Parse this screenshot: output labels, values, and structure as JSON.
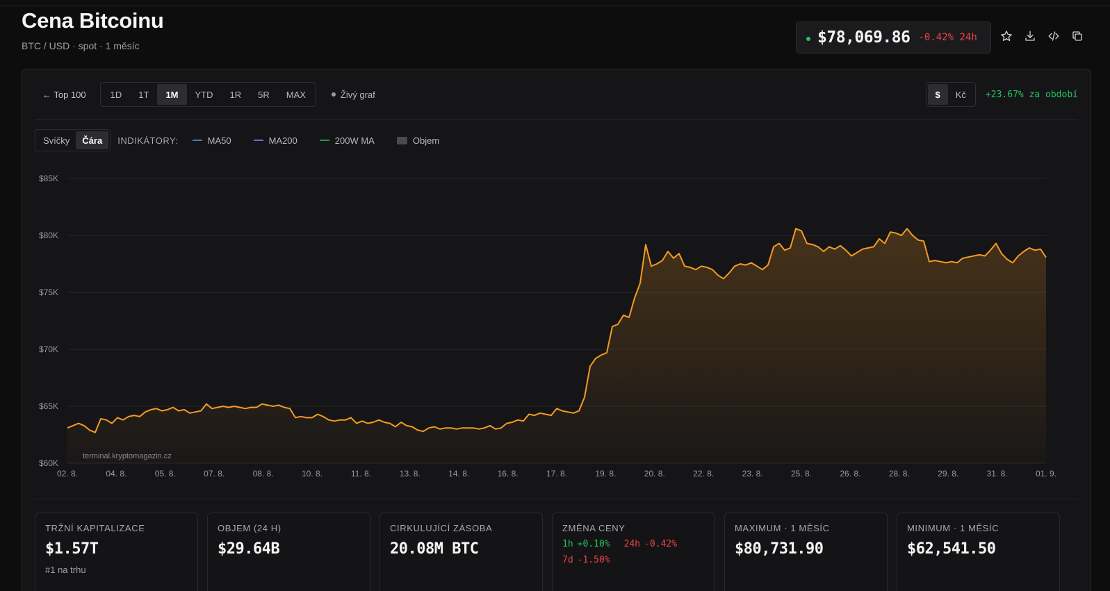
{
  "header": {
    "title": "Cena Bitcoinu",
    "subtitle": "BTC / USD · spot · 1 měsíc"
  },
  "price": {
    "value": "$78,069.86",
    "change": "-0.42% 24h"
  },
  "header_icons": [
    "star-icon",
    "download-icon",
    "embed-code-icon",
    "copy-icon"
  ],
  "toolbar": {
    "back_label": "← Top 100",
    "ranges": [
      "1D",
      "1T",
      "1M",
      "YTD",
      "1R",
      "5R",
      "MAX"
    ],
    "active_range": "1M",
    "live_label": "Živý graf",
    "currencies": [
      "$",
      "Kč"
    ],
    "active_currency": "$",
    "period_change": "+23.67% za období"
  },
  "indicators": {
    "types": [
      "Svíčky",
      "Čára"
    ],
    "active_type": "Čára",
    "label": "INDIKÁTORY:",
    "items": [
      {
        "name": "MA50",
        "color": "#3b82c4"
      },
      {
        "name": "MA200",
        "color": "#8b5cf6"
      },
      {
        "name": "200W MA",
        "color": "#16a34a"
      },
      {
        "name": "Objem",
        "color": "#4a4a4f"
      }
    ]
  },
  "watermark": "terminal.kryptomagazin.cz",
  "colors": {
    "line": "#f59a23",
    "positive": "#22c55e",
    "negative": "#ef4444"
  },
  "chart_data": {
    "type": "area",
    "ylim": [
      60000,
      85000
    ],
    "y_ticks": [
      60000,
      65000,
      70000,
      75000,
      80000,
      85000
    ],
    "y_tick_labels": [
      "$60K",
      "$65K",
      "$70K",
      "$75K",
      "$80K",
      "$85K"
    ],
    "x_tick_labels": [
      "02. 8.",
      "04. 8.",
      "05. 8.",
      "07. 8.",
      "08. 8.",
      "10. 8.",
      "11. 8.",
      "13. 8.",
      "14. 8.",
      "16. 8.",
      "17. 8.",
      "19. 8.",
      "20. 8.",
      "22. 8.",
      "23. 8.",
      "25. 8.",
      "26. 8.",
      "28. 8.",
      "29. 8.",
      "31. 8.",
      "01. 9."
    ],
    "grid": true,
    "series": [
      {
        "values": [
          63100,
          63300,
          63500,
          63300,
          62900,
          62700,
          63900,
          63800,
          63500,
          64000,
          63800,
          64100,
          64200,
          64100,
          64500,
          64700,
          64800,
          64600,
          64700,
          64900,
          64600,
          64700,
          64400,
          64500,
          64600,
          65200,
          64800,
          64900,
          65000,
          64900,
          65000,
          64900,
          64800,
          64900,
          64900,
          65200,
          65100,
          65000,
          65100,
          64900,
          64800,
          64000,
          64100,
          64000,
          64000,
          64300,
          64100,
          63800,
          63700,
          63800,
          63800,
          64000,
          63500,
          63700,
          63500,
          63600,
          63800,
          63600,
          63500,
          63200,
          63600,
          63300,
          63200,
          62900,
          62800,
          63100,
          63200,
          63000,
          63100,
          63100,
          63000,
          63100,
          63100,
          63100,
          63000,
          63100,
          63300,
          63000,
          63100,
          63500,
          63600,
          63800,
          63700,
          64300,
          64200,
          64400,
          64300,
          64200,
          64800,
          64600,
          64500,
          64400,
          64600,
          65800,
          68500,
          69200,
          69500,
          69700,
          72000,
          72200,
          73000,
          72800,
          74500,
          75800,
          79200,
          77300,
          77500,
          77800,
          78600,
          78000,
          78400,
          77300,
          77200,
          77000,
          77300,
          77200,
          77000,
          76500,
          76200,
          76700,
          77300,
          77500,
          77400,
          77600,
          77300,
          77000,
          77400,
          79000,
          79300,
          78700,
          78900,
          80600,
          80400,
          79300,
          79200,
          79000,
          78600,
          79000,
          78800,
          79100,
          78700,
          78200,
          78500,
          78800,
          78900,
          79000,
          79700,
          79300,
          80300,
          80200,
          80000,
          80600,
          80000,
          79600,
          79500,
          77700,
          77800,
          77700,
          77600,
          77700,
          77600,
          78000,
          78100,
          78200,
          78300,
          78200,
          78700,
          79300,
          78400,
          77900,
          77600,
          78200,
          78600,
          78900,
          78700,
          78800,
          78069.86
        ]
      }
    ]
  },
  "stats": [
    {
      "label": "TRŽNÍ KAPITALIZACE",
      "value": "$1.57T",
      "note": "#1 na trhu"
    },
    {
      "label": "OBJEM (24 H)",
      "value": "$29.64B"
    },
    {
      "label": "CIRKULUJÍCÍ ZÁSOBA",
      "value": "20.08M BTC"
    },
    {
      "label": "ZMĚNA CENY",
      "changes": [
        {
          "period": "1h",
          "value": "+0.10%",
          "dir": "pos"
        },
        {
          "period": "24h",
          "value": "-0.42%",
          "dir": "neg"
        },
        {
          "period": "7d",
          "value": "-1.50%",
          "dir": "neg"
        }
      ]
    },
    {
      "label": "MAXIMUM · 1 MĚSÍC",
      "value": "$80,731.90"
    },
    {
      "label": "MINIMUM · 1 MĚSÍC",
      "value": "$62,541.50"
    }
  ]
}
